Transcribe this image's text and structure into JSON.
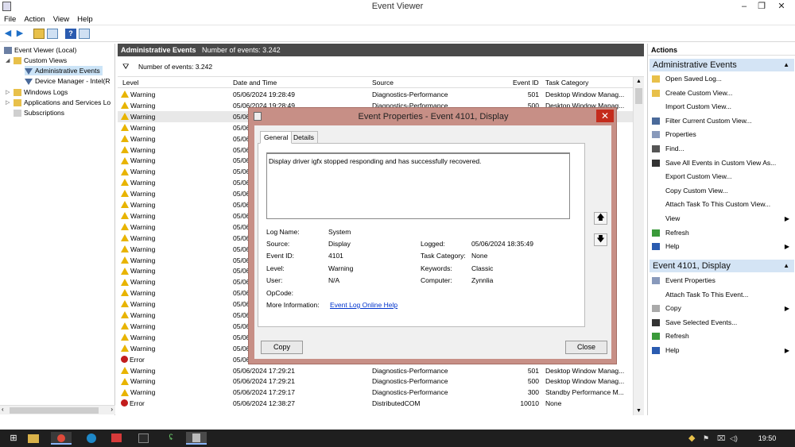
{
  "window": {
    "title": "Event Viewer",
    "min": "–",
    "max": "❐",
    "close": "✕"
  },
  "menu": [
    "File",
    "Action",
    "View",
    "Help"
  ],
  "tree": {
    "root": "Event Viewer (Local)",
    "custom_views": "Custom Views",
    "admin_events": "Administrative Events",
    "device_manager": "Device Manager - Intel(R",
    "windows_logs": "Windows Logs",
    "apps_services": "Applications and Services Lo",
    "subscriptions": "Subscriptions"
  },
  "center": {
    "header_title": "Administrative Events",
    "header_count": "Number of events: 3.242",
    "filter_count": "Number of events: 3.242",
    "columns": [
      "Level",
      "Date and Time",
      "Source",
      "Event ID",
      "Task Category"
    ]
  },
  "rows": [
    {
      "level": "Warning",
      "date": "05/06/2024 19:28:49",
      "source": "Diagnostics-Performance",
      "id": "501",
      "task": "Desktop Window Manag..."
    },
    {
      "level": "Warning",
      "date": "05/06/2024 19:28:49",
      "source": "Diagnostics-Performance",
      "id": "500",
      "task": "Desktop Window Manag..."
    },
    {
      "level": "Warning",
      "date": "05/06",
      "source": "",
      "id": "",
      "task": ""
    },
    {
      "level": "Warning",
      "date": "05/06",
      "source": "",
      "id": "",
      "task": ""
    },
    {
      "level": "Warning",
      "date": "05/06",
      "source": "",
      "id": "",
      "task": ""
    },
    {
      "level": "Warning",
      "date": "05/06",
      "source": "",
      "id": "",
      "task": ""
    },
    {
      "level": "Warning",
      "date": "05/06",
      "source": "",
      "id": "",
      "task": ""
    },
    {
      "level": "Warning",
      "date": "05/06",
      "source": "",
      "id": "",
      "task": ""
    },
    {
      "level": "Warning",
      "date": "05/06",
      "source": "",
      "id": "",
      "task": ""
    },
    {
      "level": "Warning",
      "date": "05/06",
      "source": "",
      "id": "",
      "task": ""
    },
    {
      "level": "Warning",
      "date": "05/06",
      "source": "",
      "id": "",
      "task": ""
    },
    {
      "level": "Warning",
      "date": "05/06",
      "source": "",
      "id": "",
      "task": ""
    },
    {
      "level": "Warning",
      "date": "05/06",
      "source": "",
      "id": "",
      "task": ""
    },
    {
      "level": "Warning",
      "date": "05/06",
      "source": "",
      "id": "",
      "task": ""
    },
    {
      "level": "Warning",
      "date": "05/06",
      "source": "",
      "id": "",
      "task": ""
    },
    {
      "level": "Warning",
      "date": "05/06",
      "source": "",
      "id": "",
      "task": ""
    },
    {
      "level": "Warning",
      "date": "05/06",
      "source": "",
      "id": "",
      "task": ""
    },
    {
      "level": "Warning",
      "date": "05/06",
      "source": "",
      "id": "",
      "task": ""
    },
    {
      "level": "Warning",
      "date": "05/06",
      "source": "",
      "id": "",
      "task": ""
    },
    {
      "level": "Warning",
      "date": "05/06",
      "source": "",
      "id": "",
      "task": ""
    },
    {
      "level": "Warning",
      "date": "05/06",
      "source": "",
      "id": "",
      "task": ""
    },
    {
      "level": "Warning",
      "date": "05/06",
      "source": "",
      "id": "",
      "task": ""
    },
    {
      "level": "Warning",
      "date": "05/06",
      "source": "",
      "id": "",
      "task": ""
    },
    {
      "level": "Warning",
      "date": "05/06",
      "source": "",
      "id": "",
      "task": ""
    },
    {
      "level": "Error",
      "date": "05/06",
      "source": "",
      "id": "",
      "task": ""
    },
    {
      "level": "Warning",
      "date": "05/06/2024 17:29:21",
      "source": "Diagnostics-Performance",
      "id": "501",
      "task": "Desktop Window Manag..."
    },
    {
      "level": "Warning",
      "date": "05/06/2024 17:29:21",
      "source": "Diagnostics-Performance",
      "id": "500",
      "task": "Desktop Window Manag..."
    },
    {
      "level": "Warning",
      "date": "05/06/2024 17:29:17",
      "source": "Diagnostics-Performance",
      "id": "300",
      "task": "Standby Performance M..."
    },
    {
      "level": "Error",
      "date": "05/06/2024 12:38:27",
      "source": "DistributedCOM",
      "id": "10010",
      "task": "None"
    }
  ],
  "actions": {
    "header": "Actions",
    "section1": "Administrative Events",
    "items1": [
      "Open Saved Log...",
      "Create Custom View...",
      "Import Custom View...",
      "Filter Current Custom View...",
      "Properties",
      "Find...",
      "Save All Events in Custom View As...",
      "Export Custom View...",
      "Copy Custom View...",
      "Attach Task To This Custom View...",
      "View",
      "Refresh",
      "Help"
    ],
    "section2": "Event 4101, Display",
    "items2": [
      "Event Properties",
      "Attach Task To This Event...",
      "Copy",
      "Save Selected Events...",
      "Refresh",
      "Help"
    ]
  },
  "dialog": {
    "title": "Event Properties - Event 4101, Display",
    "tab_general": "General",
    "tab_details": "Details",
    "message": "Display driver igfx stopped responding and has successfully recovered.",
    "labels": {
      "log_name": "Log Name:",
      "source": "Source:",
      "event_id": "Event ID:",
      "level": "Level:",
      "user": "User:",
      "opcode": "OpCode:",
      "more_info": "More Information:",
      "logged": "Logged:",
      "task_category": "Task Category:",
      "keywords": "Keywords:",
      "computer": "Computer:"
    },
    "values": {
      "log_name": "System",
      "source": "Display",
      "event_id": "4101",
      "level": "Warning",
      "user": "N/A",
      "opcode": "",
      "more_info": "Event Log Online Help",
      "logged": "05/06/2024 18:35:49",
      "task_category": "None",
      "keywords": "Classic",
      "computer": "Zynnlia"
    },
    "copy": "Copy",
    "close": "Close"
  },
  "taskbar": {
    "time": "19:50"
  }
}
